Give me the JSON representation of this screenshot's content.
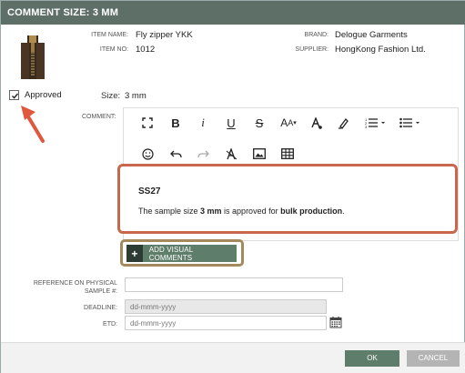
{
  "dialog": {
    "title": "COMMENT SIZE: 3 MM"
  },
  "item": {
    "name_label": "ITEM NAME:",
    "name": "Fly zipper YKK",
    "no_label": "ITEM NO:",
    "no": "1012",
    "brand_label": "BRAND:",
    "brand": "Delogue Garments",
    "supplier_label": "SUPPLIER:",
    "supplier": "HongKong Fashion Ltd."
  },
  "approval": {
    "label": "Approved",
    "checked": true
  },
  "size": {
    "label": "Size:",
    "value": "3 mm"
  },
  "comment": {
    "label": "COMMENT:",
    "toolbar_icons": [
      "fullscreen-icon",
      "bold-icon",
      "italic-icon",
      "underline-icon",
      "strikethrough-icon",
      "font-size-icon",
      "text-color-icon",
      "highlight-icon",
      "ordered-list-icon",
      "unordered-list-icon",
      "emoji-icon",
      "undo-icon",
      "redo-icon",
      "clear-format-icon",
      "image-icon",
      "table-icon"
    ],
    "content_title": "SS27",
    "content_text_1": "The sample size ",
    "content_bold_1": "3 mm",
    "content_text_2": " is approved for ",
    "content_bold_2": "bulk production",
    "content_text_3": "."
  },
  "add_visual": {
    "label": "ADD VISUAL COMMENTS"
  },
  "fields": {
    "reference_label": "REFERENCE ON PHYSICAL SAMPLE #:",
    "reference_value": "",
    "deadline_label": "DEADLINE:",
    "deadline_placeholder": "dd-mmm-yyyy",
    "etd_label": "ETD:",
    "etd_placeholder": "dd-mmm-yyyy"
  },
  "footer": {
    "ok": "OK",
    "cancel": "CANCEL"
  },
  "colors": {
    "titlebar": "#5e6f68",
    "accent_green": "#5f7d6b",
    "highlight_red": "#c8664e",
    "highlight_gold": "#a3895c"
  }
}
